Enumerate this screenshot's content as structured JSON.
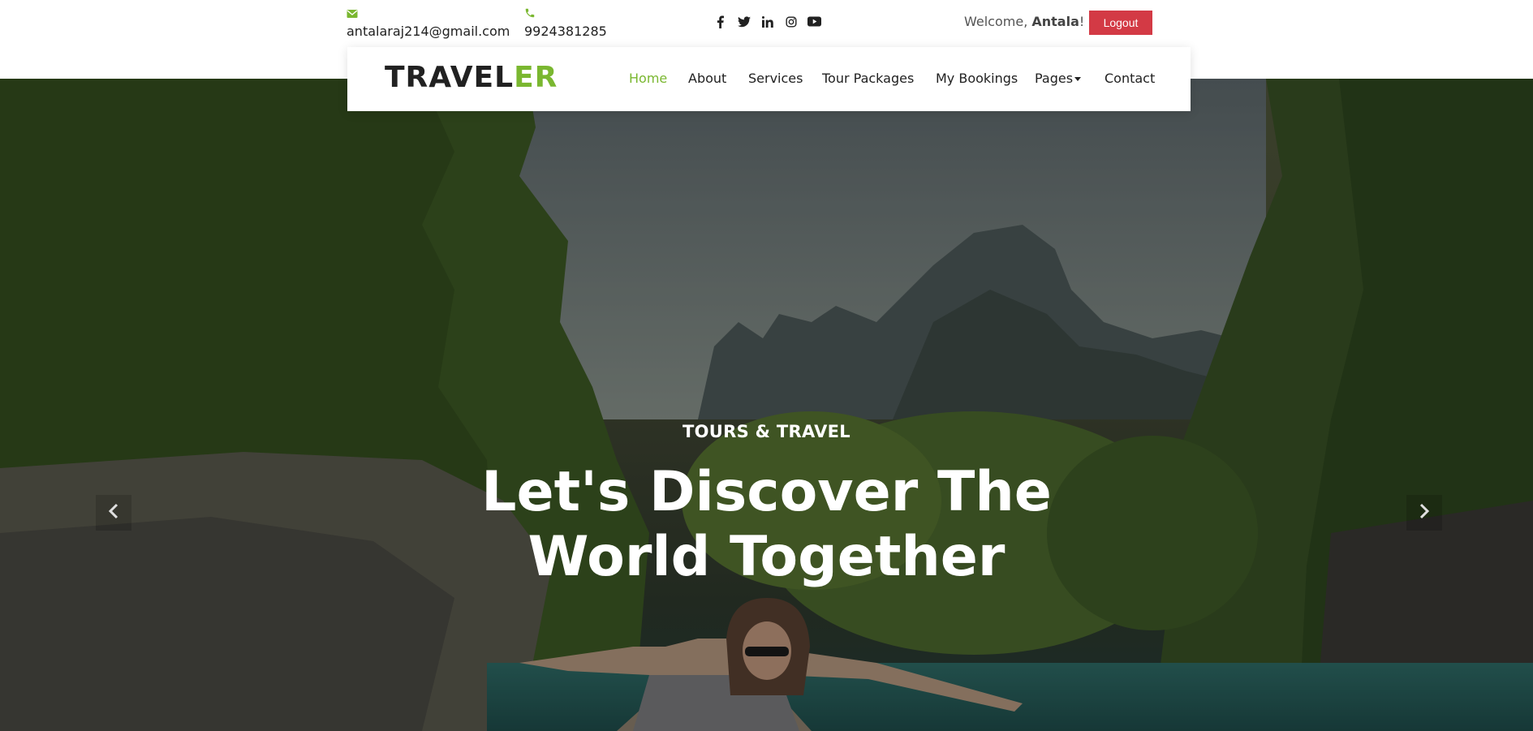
{
  "topbar": {
    "email": "antalaraj214@gmail.com",
    "phone": "9924381285",
    "social_icons": [
      "facebook-icon",
      "twitter-icon",
      "linkedin-icon",
      "instagram-icon",
      "youtube-icon"
    ],
    "welcome_prefix": "Welcome,",
    "username": "Antala",
    "welcome_suffix": "!",
    "logout_label": "Logout"
  },
  "navbar": {
    "logo_main": "TRAVEL",
    "logo_accent": "ER",
    "items": [
      {
        "label": "Home"
      },
      {
        "label": "About"
      },
      {
        "label": "Services"
      },
      {
        "label": "Tour Packages"
      },
      {
        "label": "My Bookings"
      },
      {
        "label": "Pages"
      },
      {
        "label": "Contact"
      }
    ]
  },
  "hero": {
    "kicker": "TOURS & TRAVEL",
    "title_line1": "Let's Discover The",
    "title_line2": "World Together"
  },
  "colors": {
    "accent": "#7ab730",
    "logout": "#d33a45",
    "text": "#212121"
  }
}
